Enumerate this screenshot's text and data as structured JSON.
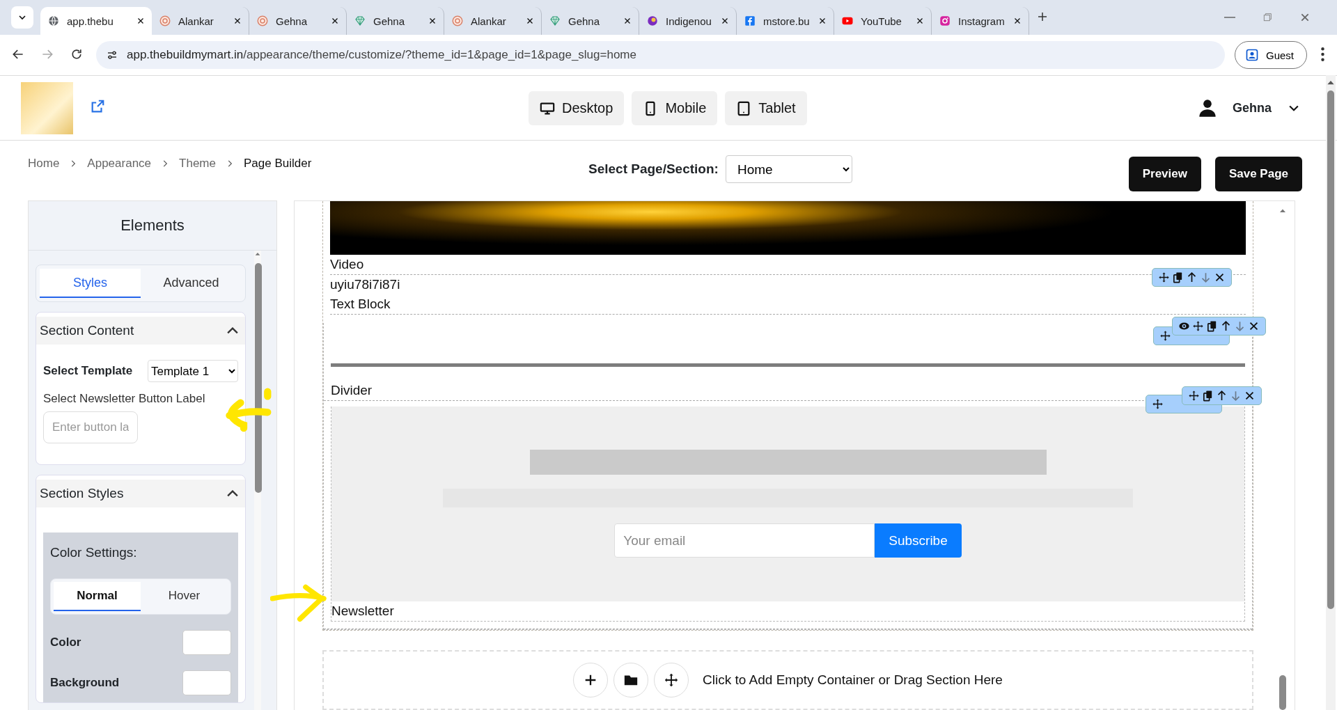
{
  "browser": {
    "tabs": [
      {
        "title": "app.thebu",
        "kind": "globe",
        "selected": true
      },
      {
        "title": "Alankar",
        "kind": "ring",
        "selected": false
      },
      {
        "title": "Gehna",
        "kind": "ring",
        "selected": false
      },
      {
        "title": "Gehna",
        "kind": "gem",
        "selected": false
      },
      {
        "title": "Alankar",
        "kind": "ring",
        "selected": false
      },
      {
        "title": "Gehna",
        "kind": "gem",
        "selected": false
      },
      {
        "title": "Indigenou",
        "kind": "purple",
        "selected": false
      },
      {
        "title": "mstore.bu",
        "kind": "facebook",
        "selected": false
      },
      {
        "title": "YouTube",
        "kind": "youtube",
        "selected": false
      },
      {
        "title": "Instagram",
        "kind": "instagram",
        "selected": false
      }
    ],
    "url_host": "app.thebuildmymart.in",
    "url_path": "/appearance/theme/customize/?theme_id=1&page_id=1&page_slug=home",
    "profile": "Guest"
  },
  "header": {
    "view_modes": [
      {
        "label": "Desktop",
        "kind": "desktop"
      },
      {
        "label": "Mobile",
        "kind": "mobile"
      },
      {
        "label": "Tablet",
        "kind": "tablet"
      }
    ],
    "user": "Gehna"
  },
  "breadcrumb": [
    "Home",
    "Appearance",
    "Theme",
    "Page Builder"
  ],
  "page_select": {
    "label": "Select Page/Section:",
    "value": "Home"
  },
  "actions": [
    "Preview",
    "Save Page"
  ],
  "panel": {
    "title": "Elements",
    "tabs": [
      {
        "label": "Styles",
        "selected": true
      },
      {
        "label": "Advanced",
        "selected": false
      }
    ],
    "section_content": {
      "title": "Section Content",
      "expanded": true,
      "template_label": "Select Template",
      "template_value": "Template 1",
      "button_label": "Select Newsletter Button Label",
      "button_placeholder": "Enter button la"
    },
    "section_styles": {
      "title": "Section Styles",
      "expanded": true,
      "color_title": "Color Settings:",
      "state_tabs": [
        {
          "label": "Normal",
          "selected": true
        },
        {
          "label": "Hover",
          "selected": false
        }
      ],
      "fields": [
        "Color",
        "Background"
      ]
    }
  },
  "canvas": {
    "video_label": "Video",
    "text_block_text": "uyiu78i7i87i",
    "text_block_label": "Text Block",
    "divider_label": "Divider",
    "newsletter": {
      "email_placeholder": "Your email",
      "button": "Subscribe",
      "label": "Newsletter"
    },
    "add_section_text": "Click to Add Empty Container or Drag Section Here"
  }
}
